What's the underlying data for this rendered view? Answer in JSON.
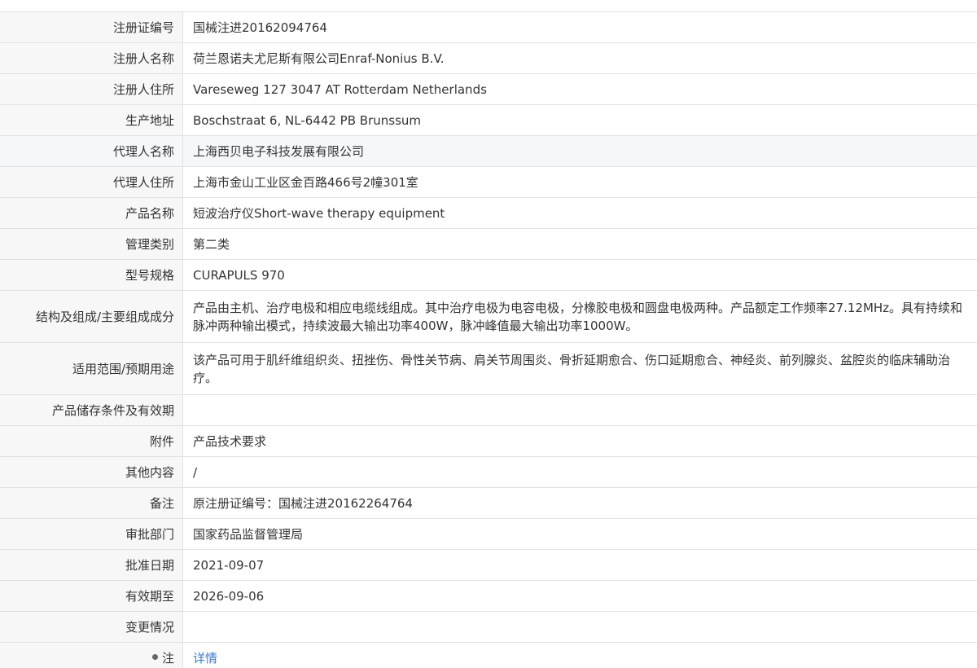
{
  "rows": [
    {
      "label": "注册证编号",
      "value": "国械注进20162094764"
    },
    {
      "label": "注册人名称",
      "value": "荷兰恩诺夫尤尼斯有限公司Enraf-Nonius B.V."
    },
    {
      "label": "注册人住所",
      "value": "Vareseweg 127 3047 AT Rotterdam Netherlands"
    },
    {
      "label": "生产地址",
      "value": "Boschstraat 6, NL-6442 PB Brunssum"
    },
    {
      "label": "代理人名称",
      "value": "上海西贝电子科技发展有限公司"
    },
    {
      "label": "代理人住所",
      "value": "上海市金山工业区金百路466号2幢301室"
    },
    {
      "label": "产品名称",
      "value": "短波治疗仪Short-wave therapy equipment"
    },
    {
      "label": "管理类别",
      "value": "第二类"
    },
    {
      "label": "型号规格",
      "value": "CURAPULS 970"
    },
    {
      "label": "结构及组成/主要组成成分",
      "value": "产品由主机、治疗电极和相应电缆线组成。其中治疗电极为电容电极，分橡胶电极和圆盘电极两种。产品额定工作频率27.12MHz。具有持续和脉冲两种输出模式，持续波最大输出功率400W，脉冲峰值最大输出功率1000W。"
    },
    {
      "label": "适用范围/预期用途",
      "value": "该产品可用于肌纤维组织炎、扭挫伤、骨性关节病、肩关节周围炎、骨折延期愈合、伤口延期愈合、神经炎、前列腺炎、盆腔炎的临床辅助治疗。"
    },
    {
      "label": "产品储存条件及有效期",
      "value": ""
    },
    {
      "label": "附件",
      "value": "产品技术要求"
    },
    {
      "label": "其他内容",
      "value": "/"
    },
    {
      "label": "备注",
      "value": "原注册证编号：国械注进20162264764"
    },
    {
      "label": "审批部门",
      "value": "国家药品监督管理局"
    },
    {
      "label": "批准日期",
      "value": "2021-09-07"
    },
    {
      "label": "有效期至",
      "value": "2026-09-06"
    },
    {
      "label": "变更情况",
      "value": ""
    }
  ],
  "note_row": {
    "label": "注",
    "link": "详情"
  }
}
